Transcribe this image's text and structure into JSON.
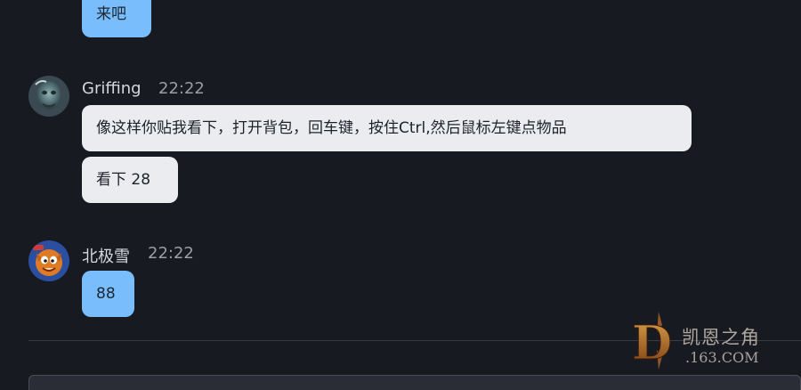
{
  "messages": [
    {
      "text": "来吧"
    },
    {
      "sender": "Griffing",
      "time": "22:22",
      "bubbles": [
        "像这样你贴我看下，打开背包，回车键，按住Ctrl,然后鼠标左键点物品",
        "看下 28"
      ]
    },
    {
      "sender": "北极雪",
      "time": "22:22",
      "bubbles": [
        "88"
      ]
    }
  ],
  "watermark": {
    "brand": "凯恩之角",
    "domain": ".163.COM",
    "letter": "D"
  },
  "colors": {
    "background": "#181a22",
    "self_bubble": "#79bdfd",
    "other_bubble": "#eaecf0",
    "name_text": "#d5d7dd",
    "time_text": "#9a9ea7"
  }
}
